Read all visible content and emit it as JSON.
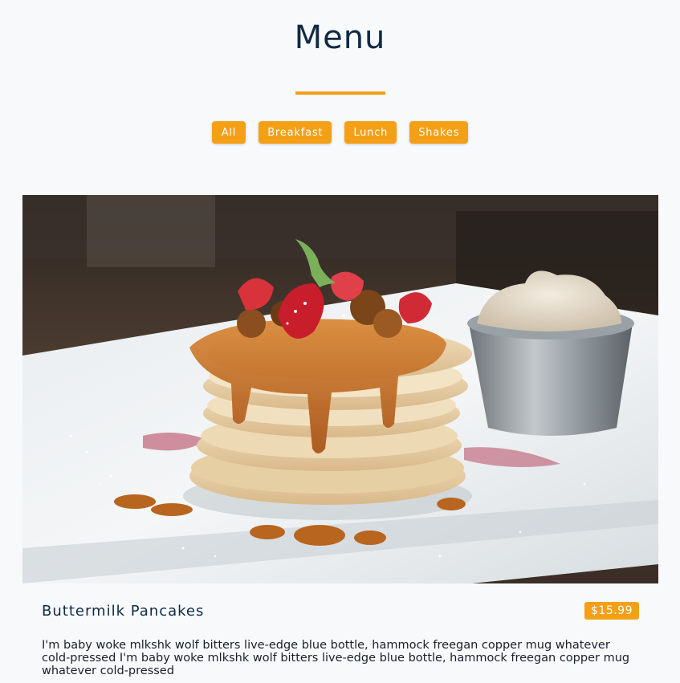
{
  "header": {
    "title": "Menu"
  },
  "filters": [
    {
      "label": "All"
    },
    {
      "label": "Breakfast"
    },
    {
      "label": "Lunch"
    },
    {
      "label": "Shakes"
    }
  ],
  "colors": {
    "accent": "#f4a017",
    "background": "#f7f9fb",
    "title": "#102a43"
  },
  "menu_item": {
    "name": "Buttermilk Pancakes",
    "price": "$15.99",
    "description": "I'm baby woke mlkshk wolf bitters live-edge blue bottle, hammock freegan copper mug whatever cold-pressed I'm baby woke mlkshk wolf bitters live-edge blue bottle, hammock freegan copper mug whatever cold-pressed",
    "image": "pancake-stack-photo"
  }
}
